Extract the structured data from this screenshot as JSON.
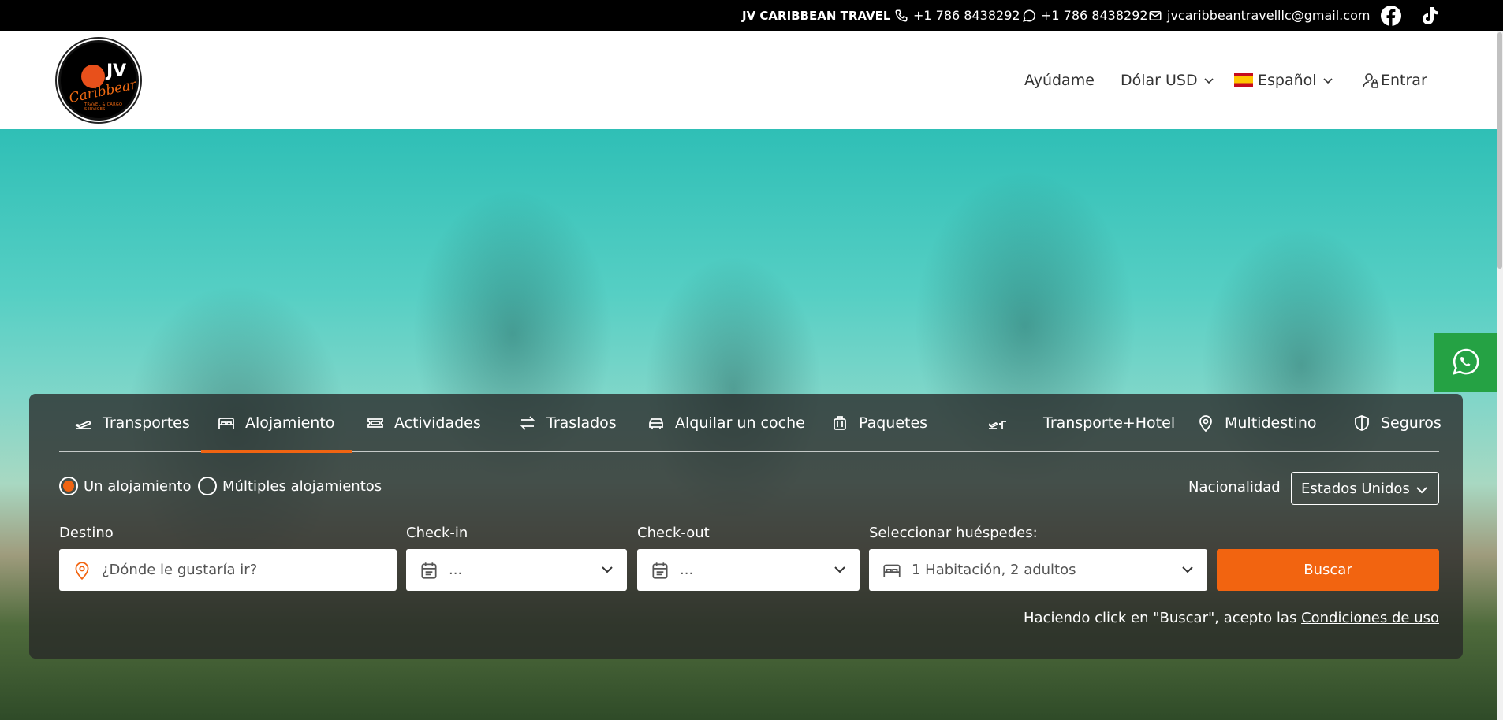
{
  "topbar": {
    "brand": "JV CARIBBEAN TRAVEL",
    "phone": "+1 786 8438292",
    "whatsapp": "+1 786 8438292",
    "email": "jvcaribbeantravelllc@gmail.com",
    "icons": [
      "phone-icon",
      "whatsapp-icon",
      "mail-icon",
      "facebook-icon",
      "tiktok-icon"
    ]
  },
  "header": {
    "logo_text": "JV",
    "logo_script": "Caribbean",
    "logo_small": "TRAVEL & CARGO SERVICES",
    "nav": {
      "help": "Ayúdame",
      "currency": "Dólar USD",
      "language": "Español",
      "login": "Entrar"
    }
  },
  "search": {
    "tabs": [
      {
        "label": "Transportes",
        "icon": "plane-icon"
      },
      {
        "label": "Alojamiento",
        "icon": "bed-icon",
        "active": true
      },
      {
        "label": "Actividades",
        "icon": "ticket-icon"
      },
      {
        "label": "Traslados",
        "icon": "arrows-icon"
      },
      {
        "label": "Alquilar un coche",
        "icon": "car-icon"
      },
      {
        "label": "Paquetes",
        "icon": "luggage-icon"
      },
      {
        "label": "Transporte+Hotel",
        "icon": "plane-bed-icon"
      },
      {
        "label": "Multidestino",
        "icon": "pin-icon"
      },
      {
        "label": "Seguros",
        "icon": "shield-icon"
      }
    ],
    "mode_single": "Un alojamiento",
    "mode_multi": "Múltiples alojamientos",
    "nationality_label": "Nacionalidad",
    "nationality_value": "Estados Unidos",
    "destination_label": "Destino",
    "destination_placeholder": "¿Dónde le gustaría ir?",
    "checkin_label": "Check-in",
    "checkin_value": "...",
    "checkout_label": "Check-out",
    "checkout_value": "...",
    "guests_label": "Seleccionar huéspedes:",
    "guests_value": "1 Habitación, 2 adultos",
    "submit_label": "Buscar",
    "terms_prefix": "Haciendo click en \"Buscar\", acepto las ",
    "terms_link": "Condiciones de uso"
  },
  "colors": {
    "accent": "#f26410",
    "topbar": "#000000",
    "whatsapp": "#25a244"
  }
}
